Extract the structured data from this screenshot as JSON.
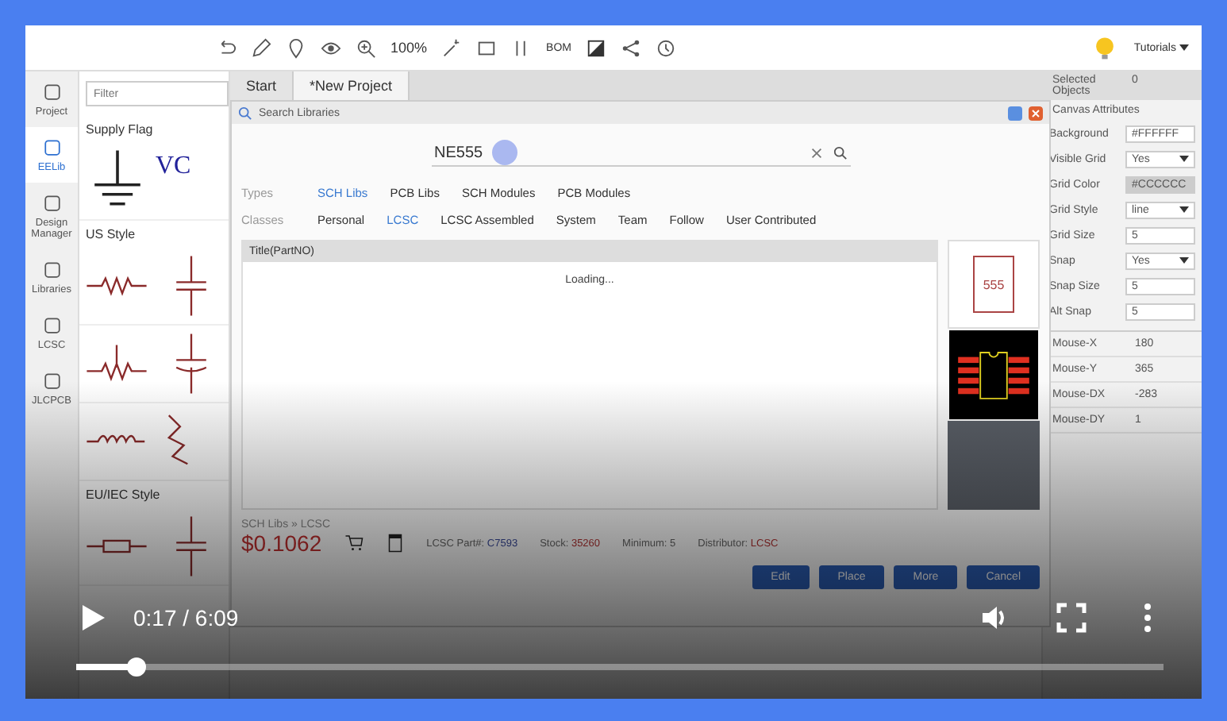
{
  "toolbar": {
    "zoom": "100%",
    "bom": "BOM",
    "tutorials": "Tutorials"
  },
  "left_nav": [
    {
      "label": "Project",
      "selected": false
    },
    {
      "label": "EELib",
      "selected": true
    },
    {
      "label": "Design Manager",
      "selected": false
    },
    {
      "label": "Libraries",
      "selected": false
    },
    {
      "label": "LCSC",
      "selected": false
    },
    {
      "label": "JLCPCB",
      "selected": false
    }
  ],
  "library": {
    "filter_placeholder": "Filter",
    "sections": [
      "Supply Flag",
      "US Style",
      "EU/IEC Style"
    ],
    "vcc_label": "VC"
  },
  "tabs": [
    {
      "label": "Start",
      "selected": false
    },
    {
      "label": "*New Project",
      "selected": true
    }
  ],
  "dialog": {
    "title": "Search Libraries",
    "search_value": "NE555",
    "types_label": "Types",
    "types": [
      {
        "label": "SCH Libs",
        "selected": true
      },
      {
        "label": "PCB Libs",
        "selected": false
      },
      {
        "label": "SCH Modules",
        "selected": false
      },
      {
        "label": "PCB Modules",
        "selected": false
      }
    ],
    "classes_label": "Classes",
    "classes": [
      {
        "label": "Personal",
        "selected": false
      },
      {
        "label": "LCSC",
        "selected": true
      },
      {
        "label": "LCSC Assembled",
        "selected": false
      },
      {
        "label": "System",
        "selected": false
      },
      {
        "label": "Team",
        "selected": false
      },
      {
        "label": "Follow",
        "selected": false
      },
      {
        "label": "User Contributed",
        "selected": false
      }
    ],
    "column": "Title(PartNO)",
    "status": "Loading...",
    "chip_label": "555",
    "breadcrumb": "SCH Libs » LCSC",
    "price": "$0.1062",
    "details": [
      {
        "label": "LCSC Part#:",
        "value": "C7593",
        "kind": "link"
      },
      {
        "label": "Stock:",
        "value": "35260",
        "kind": "highlight"
      },
      {
        "label": "Minimum:",
        "value": "5",
        "kind": "plain"
      },
      {
        "label": "Distributor:",
        "value": "LCSC",
        "kind": "highlight"
      }
    ],
    "buttons": [
      "Edit",
      "Place",
      "More",
      "Cancel"
    ]
  },
  "properties": {
    "selected_label": "Selected Objects",
    "selected_value": "0",
    "section": "Canvas Attributes",
    "attributes": [
      {
        "label": "Background",
        "value": "#FFFFFF",
        "kind": "input"
      },
      {
        "label": "Visible Grid",
        "value": "Yes",
        "kind": "select"
      },
      {
        "label": "Grid Color",
        "value": "#CCCCCC",
        "kind": "color"
      },
      {
        "label": "Grid Style",
        "value": "line",
        "kind": "select"
      },
      {
        "label": "Grid Size",
        "value": "5",
        "kind": "input"
      },
      {
        "label": "Snap",
        "value": "Yes",
        "kind": "select"
      },
      {
        "label": "Snap Size",
        "value": "5",
        "kind": "input"
      },
      {
        "label": "Alt Snap",
        "value": "5",
        "kind": "input"
      }
    ],
    "mouse": [
      {
        "label": "Mouse-X",
        "value": "180"
      },
      {
        "label": "Mouse-Y",
        "value": "365"
      },
      {
        "label": "Mouse-DX",
        "value": "-283"
      },
      {
        "label": "Mouse-DY",
        "value": "1"
      }
    ]
  },
  "video": {
    "time": "0:17 / 6:09",
    "progress": {
      "level": 0.055
    }
  }
}
